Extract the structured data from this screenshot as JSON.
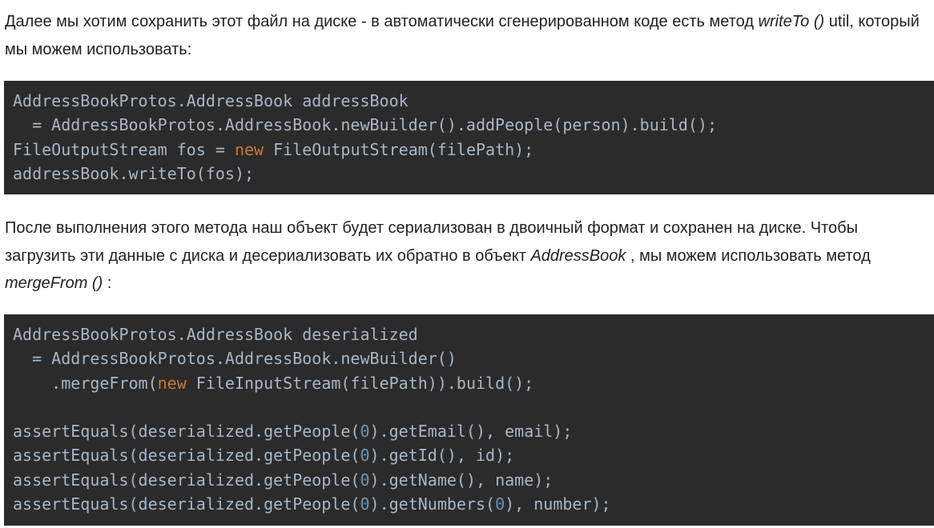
{
  "paragraph1": {
    "text_a": "Далее мы хотим сохранить этот файл на диске - в автоматически сгенерированном коде есть метод ",
    "em": "writeTo ()",
    "text_b": " util, который мы можем использовать:"
  },
  "code1": [
    [
      {
        "t": "AddressBookProtos.AddressBook addressBook",
        "c": ""
      }
    ],
    [
      {
        "t": "  = AddressBookProtos.AddressBook.newBuilder().addPeople(person).build();",
        "c": ""
      }
    ],
    [
      {
        "t": "FileOutputStream fos = ",
        "c": ""
      },
      {
        "t": "new",
        "c": "kw"
      },
      {
        "t": " FileOutputStream(filePath);",
        "c": ""
      }
    ],
    [
      {
        "t": "addressBook.writeTo(fos);",
        "c": ""
      }
    ]
  ],
  "paragraph2": {
    "text_a": "После выполнения этого метода наш объект будет сериализован в двоичный формат и сохранен на диске. Чтобы загрузить эти данные с диска и десериализовать их обратно в объект ",
    "em1": "AddressBook",
    "text_b": " , мы можем использовать метод ",
    "em2": "mergeFrom ()",
    "text_c": " :"
  },
  "code2": [
    [
      {
        "t": "AddressBookProtos.AddressBook deserialized",
        "c": ""
      }
    ],
    [
      {
        "t": "  = AddressBookProtos.AddressBook.newBuilder()",
        "c": ""
      }
    ],
    [
      {
        "t": "    .mergeFrom(",
        "c": ""
      },
      {
        "t": "new",
        "c": "kw"
      },
      {
        "t": " FileInputStream(filePath)).build();",
        "c": ""
      }
    ],
    [
      {
        "t": "",
        "c": ""
      }
    ],
    [
      {
        "t": "assertEquals(deserialized.getPeople(",
        "c": ""
      },
      {
        "t": "0",
        "c": "num"
      },
      {
        "t": ").getEmail(), email);",
        "c": ""
      }
    ],
    [
      {
        "t": "assertEquals(deserialized.getPeople(",
        "c": ""
      },
      {
        "t": "0",
        "c": "num"
      },
      {
        "t": ").getId(), id);",
        "c": ""
      }
    ],
    [
      {
        "t": "assertEquals(deserialized.getPeople(",
        "c": ""
      },
      {
        "t": "0",
        "c": "num"
      },
      {
        "t": ").getName(), name);",
        "c": ""
      }
    ],
    [
      {
        "t": "assertEquals(deserialized.getPeople(",
        "c": ""
      },
      {
        "t": "0",
        "c": "num"
      },
      {
        "t": ").getNumbers(",
        "c": ""
      },
      {
        "t": "0",
        "c": "num"
      },
      {
        "t": "), number);",
        "c": ""
      }
    ]
  ],
  "colors": {
    "code_bg": "#2b2b2b",
    "code_text": "#a9b7c6",
    "keyword": "#cc7832",
    "number": "#6897bb"
  }
}
